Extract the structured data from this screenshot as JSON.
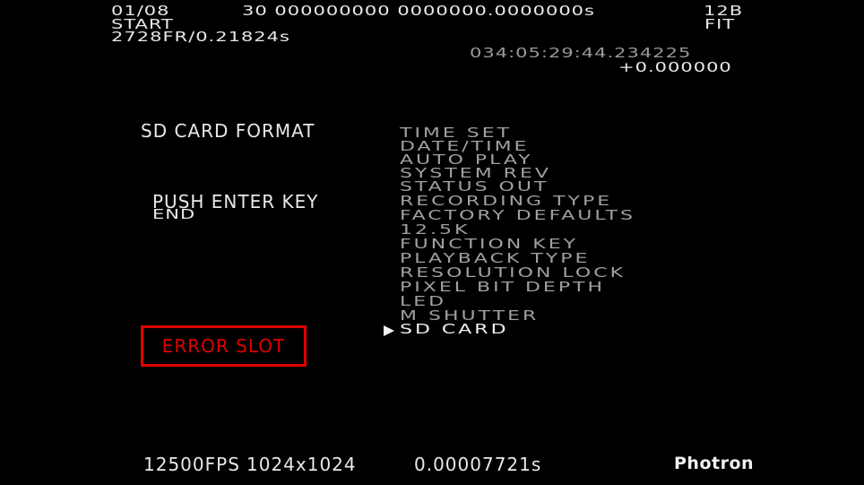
{
  "header": {
    "counter": "01/08",
    "mode": "START",
    "frames": "2728FR/0.21824s",
    "trigger_info": "30 000000000 0000000.0000000s",
    "bit_depth": "12B",
    "fit": "FIT",
    "timecode": "034:05:29:44.234225",
    "offset": "+0.000000"
  },
  "left_panel": {
    "title": "SD CARD FORMAT",
    "instruction": "PUSH ENTER KEY",
    "end_label": "END",
    "error_label": "ERROR SLOT"
  },
  "menu": {
    "items": [
      "TIME SET",
      "DATE/TIME",
      "AUTO PLAY",
      "SYSTEM REV",
      "STATUS OUT",
      "RECORDING TYPE",
      "FACTORY DEFAULTS",
      "12.5K",
      "FUNCTION KEY",
      "PLAYBACK TYPE",
      "RESOLUTION LOCK",
      "PIXEL BIT DEPTH",
      "LED",
      "M SHUTTER",
      "SD CARD"
    ],
    "selected_index": 14
  },
  "footer": {
    "fps": "12500FPS",
    "resolution": "1024x1024",
    "shutter": "0.00007721s",
    "brand": "Photron"
  },
  "colors": {
    "background": "#000000",
    "text": "#e8e8e8",
    "menu_dim": "#a0a0a0",
    "error": "#e00000"
  }
}
